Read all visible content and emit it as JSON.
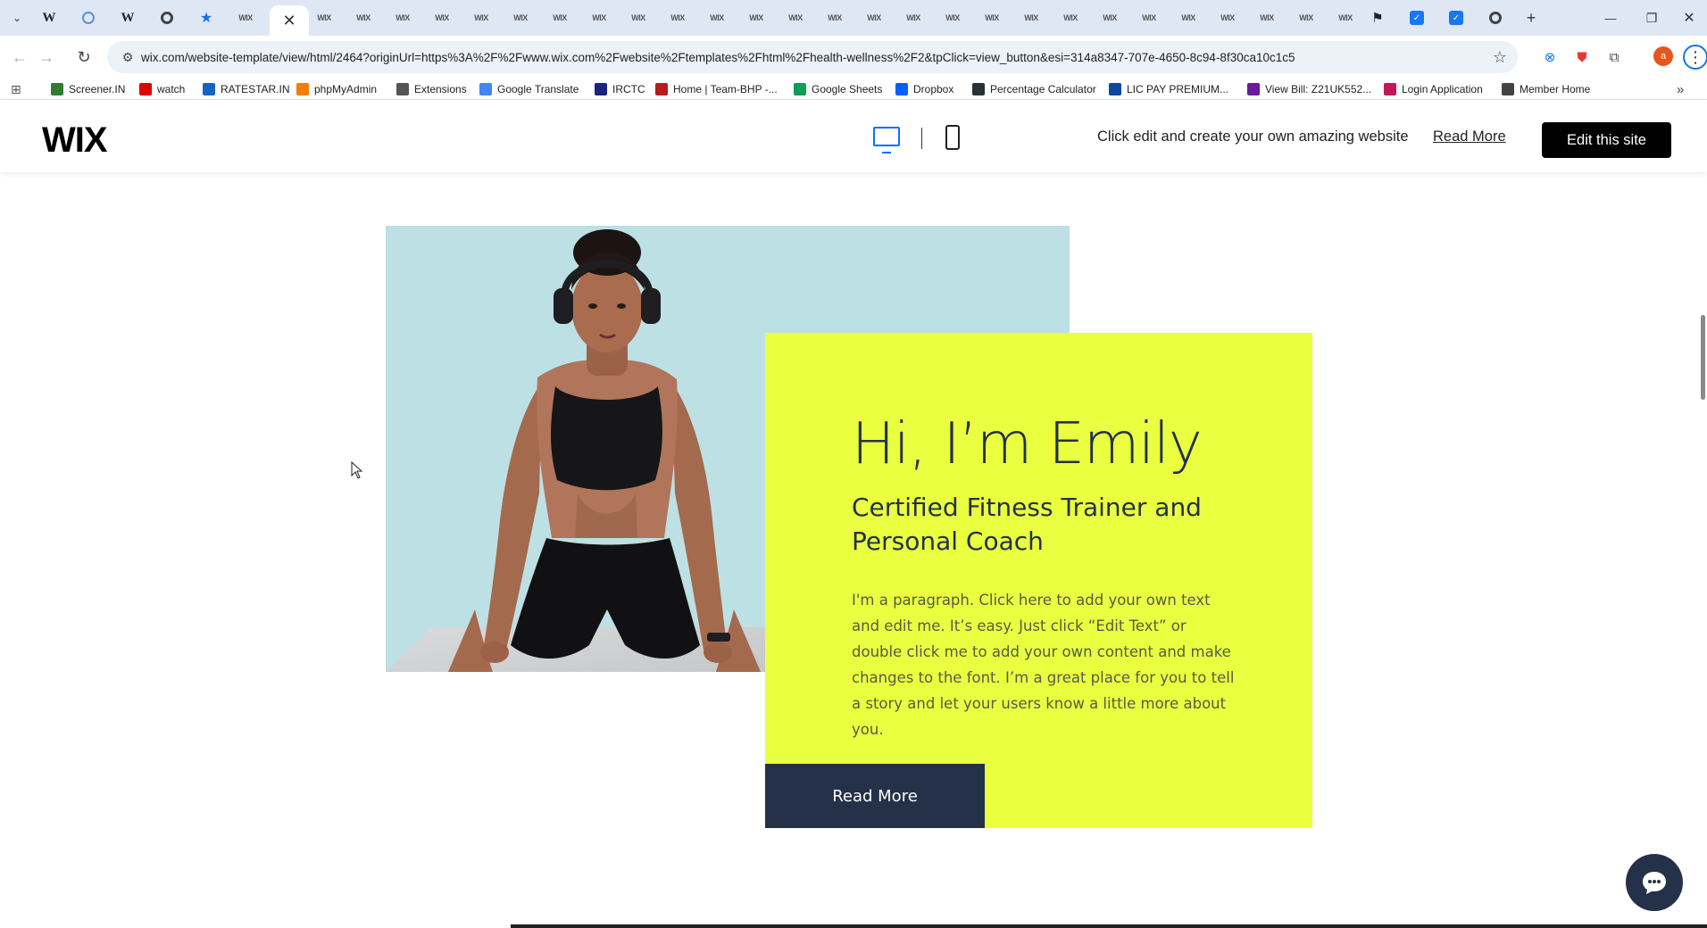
{
  "browser": {
    "tabs": [
      {
        "icon": "tab-search-icon"
      },
      {
        "icon": "wikipedia-icon",
        "glyph": "W"
      },
      {
        "icon": "globe-icon"
      },
      {
        "icon": "wikipedia-icon",
        "glyph": "W"
      },
      {
        "icon": "chrome-icon"
      },
      {
        "icon": "star-icon",
        "glyph": "★"
      },
      {
        "icon": "wix-icon",
        "glyph": "WIX"
      }
    ],
    "active_tab_close": "✕",
    "wix_tab_glyph": "WIX",
    "controls": {
      "new_tab": "+",
      "minimize": "—",
      "restore": "❐",
      "close": "✕"
    },
    "url": "wix.com/website-template/view/html/2464?originUrl=https%3A%2F%2Fwww.wix.com%2Fwebsite%2Ftemplates%2Fhtml%2Fhealth-wellness%2F2&tpClick=view_button&esi=314a8347-707e-4650-8c94-8f30ca10c1c5",
    "profile_initial": "a",
    "bookmarks": [
      {
        "label": "Screener.IN",
        "color": "#2e7d32"
      },
      {
        "label": "watch",
        "color": "#e00000"
      },
      {
        "label": "RATESTAR.IN",
        "color": "#1565c0"
      },
      {
        "label": "phpMyAdmin",
        "color": "#f57c00"
      },
      {
        "label": "Extensions",
        "color": "#555555"
      },
      {
        "label": "Google Translate",
        "color": "#4285f4"
      },
      {
        "label": "IRCTC",
        "color": "#1a237e"
      },
      {
        "label": "Home | Team-BHP -...",
        "color": "#b71c1c"
      },
      {
        "label": "Google Sheets",
        "color": "#0f9d58"
      },
      {
        "label": "Dropbox",
        "color": "#0061ff"
      },
      {
        "label": "Percentage Calculator",
        "color": "#263238"
      },
      {
        "label": "LIC PAY PREMIUM...",
        "color": "#0d47a1"
      },
      {
        "label": "View Bill: Z21UK552...",
        "color": "#6a1b9a"
      },
      {
        "label": "Login Application",
        "color": "#c2185b"
      },
      {
        "label": "Member Home",
        "color": "#424242"
      }
    ],
    "bookmarks_overflow": "»"
  },
  "wixbar": {
    "logo": "WIX",
    "tagline": "Click edit and create your own amazing website",
    "read_more": "Read More",
    "edit_button": "Edit this site",
    "accent": "#116dff"
  },
  "hero": {
    "title": "Hi, I’m Emily",
    "subtitle": "Certified Fitness Trainer and Personal Coach",
    "paragraph": "I'm a paragraph. Click here to add your own text and edit me. It’s easy. Just click “Edit Text” or double click me to add your own content and make changes to the font. I’m a great place for you to tell a story and let your users know a little more about you.",
    "button": "Read More",
    "colors": {
      "card": "#eaff40",
      "navy": "#243149",
      "photo_bg": "#bde0e4"
    }
  }
}
